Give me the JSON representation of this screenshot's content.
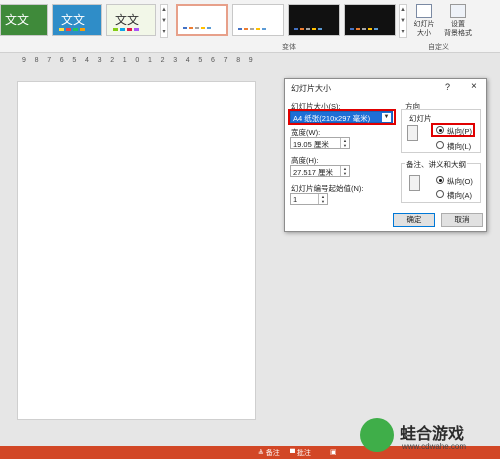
{
  "ribbon": {
    "theme_thumbs": [
      "文文",
      "文文",
      "文文"
    ],
    "variants_group_label": "变体",
    "custom_group_label": "自定义",
    "slide_size_button": "幻灯片\n大小",
    "format_bg_button": "设置\n背景格式",
    "scroll_up": "▲",
    "scroll_down": "▼",
    "scroll_more": "▾"
  },
  "ruler": {
    "ticks": [
      "9",
      "8",
      "7",
      "6",
      "5",
      "4",
      "3",
      "2",
      "1",
      "0",
      "1",
      "2",
      "3",
      "4",
      "5",
      "6",
      "7",
      "8",
      "9"
    ]
  },
  "dialog": {
    "title": "幻灯片大小",
    "help": "?",
    "close": "×",
    "size_label": "幻灯片大小(S):",
    "size_value": "A4 纸张(210x297 毫米)",
    "width_label": "宽度(W):",
    "width_value": "19.05 厘米",
    "height_label": "高度(H):",
    "height_value": "27.517 厘米",
    "number_label": "幻灯片编号起始值(N):",
    "number_value": "1",
    "orientation_label": "方向",
    "slides_label": "幻灯片",
    "slides_portrait": "纵向(P)",
    "slides_landscape": "横向(L)",
    "notes_label": "备注、讲义和大纲",
    "notes_portrait": "纵向(O)",
    "notes_landscape": "横向(A)",
    "ok": "确定",
    "cancel": "取消"
  },
  "statusbar": {
    "notes": "≜ 备注",
    "comments": "▀ 批注"
  },
  "watermark": {
    "name": "蛙合游戏",
    "url": "www.cdwahe.com"
  },
  "colors": {
    "accent": "#d24726",
    "selection": "#1e6fd6",
    "highlight_box": "#e00000",
    "logo_green": "#3fae49"
  }
}
